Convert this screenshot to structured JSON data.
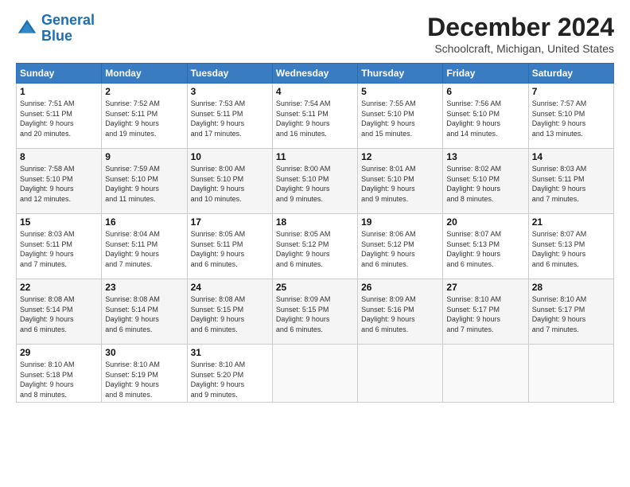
{
  "logo": {
    "line1": "General",
    "line2": "Blue"
  },
  "title": "December 2024",
  "location": "Schoolcraft, Michigan, United States",
  "days_of_week": [
    "Sunday",
    "Monday",
    "Tuesday",
    "Wednesday",
    "Thursday",
    "Friday",
    "Saturday"
  ],
  "weeks": [
    [
      {
        "day": "1",
        "info": "Sunrise: 7:51 AM\nSunset: 5:11 PM\nDaylight: 9 hours\nand 20 minutes."
      },
      {
        "day": "2",
        "info": "Sunrise: 7:52 AM\nSunset: 5:11 PM\nDaylight: 9 hours\nand 19 minutes."
      },
      {
        "day": "3",
        "info": "Sunrise: 7:53 AM\nSunset: 5:11 PM\nDaylight: 9 hours\nand 17 minutes."
      },
      {
        "day": "4",
        "info": "Sunrise: 7:54 AM\nSunset: 5:11 PM\nDaylight: 9 hours\nand 16 minutes."
      },
      {
        "day": "5",
        "info": "Sunrise: 7:55 AM\nSunset: 5:10 PM\nDaylight: 9 hours\nand 15 minutes."
      },
      {
        "day": "6",
        "info": "Sunrise: 7:56 AM\nSunset: 5:10 PM\nDaylight: 9 hours\nand 14 minutes."
      },
      {
        "day": "7",
        "info": "Sunrise: 7:57 AM\nSunset: 5:10 PM\nDaylight: 9 hours\nand 13 minutes."
      }
    ],
    [
      {
        "day": "8",
        "info": "Sunrise: 7:58 AM\nSunset: 5:10 PM\nDaylight: 9 hours\nand 12 minutes."
      },
      {
        "day": "9",
        "info": "Sunrise: 7:59 AM\nSunset: 5:10 PM\nDaylight: 9 hours\nand 11 minutes."
      },
      {
        "day": "10",
        "info": "Sunrise: 8:00 AM\nSunset: 5:10 PM\nDaylight: 9 hours\nand 10 minutes."
      },
      {
        "day": "11",
        "info": "Sunrise: 8:00 AM\nSunset: 5:10 PM\nDaylight: 9 hours\nand 9 minutes."
      },
      {
        "day": "12",
        "info": "Sunrise: 8:01 AM\nSunset: 5:10 PM\nDaylight: 9 hours\nand 9 minutes."
      },
      {
        "day": "13",
        "info": "Sunrise: 8:02 AM\nSunset: 5:10 PM\nDaylight: 9 hours\nand 8 minutes."
      },
      {
        "day": "14",
        "info": "Sunrise: 8:03 AM\nSunset: 5:11 PM\nDaylight: 9 hours\nand 7 minutes."
      }
    ],
    [
      {
        "day": "15",
        "info": "Sunrise: 8:03 AM\nSunset: 5:11 PM\nDaylight: 9 hours\nand 7 minutes."
      },
      {
        "day": "16",
        "info": "Sunrise: 8:04 AM\nSunset: 5:11 PM\nDaylight: 9 hours\nand 7 minutes."
      },
      {
        "day": "17",
        "info": "Sunrise: 8:05 AM\nSunset: 5:11 PM\nDaylight: 9 hours\nand 6 minutes."
      },
      {
        "day": "18",
        "info": "Sunrise: 8:05 AM\nSunset: 5:12 PM\nDaylight: 9 hours\nand 6 minutes."
      },
      {
        "day": "19",
        "info": "Sunrise: 8:06 AM\nSunset: 5:12 PM\nDaylight: 9 hours\nand 6 minutes."
      },
      {
        "day": "20",
        "info": "Sunrise: 8:07 AM\nSunset: 5:13 PM\nDaylight: 9 hours\nand 6 minutes."
      },
      {
        "day": "21",
        "info": "Sunrise: 8:07 AM\nSunset: 5:13 PM\nDaylight: 9 hours\nand 6 minutes."
      }
    ],
    [
      {
        "day": "22",
        "info": "Sunrise: 8:08 AM\nSunset: 5:14 PM\nDaylight: 9 hours\nand 6 minutes."
      },
      {
        "day": "23",
        "info": "Sunrise: 8:08 AM\nSunset: 5:14 PM\nDaylight: 9 hours\nand 6 minutes."
      },
      {
        "day": "24",
        "info": "Sunrise: 8:08 AM\nSunset: 5:15 PM\nDaylight: 9 hours\nand 6 minutes."
      },
      {
        "day": "25",
        "info": "Sunrise: 8:09 AM\nSunset: 5:15 PM\nDaylight: 9 hours\nand 6 minutes."
      },
      {
        "day": "26",
        "info": "Sunrise: 8:09 AM\nSunset: 5:16 PM\nDaylight: 9 hours\nand 6 minutes."
      },
      {
        "day": "27",
        "info": "Sunrise: 8:10 AM\nSunset: 5:17 PM\nDaylight: 9 hours\nand 7 minutes."
      },
      {
        "day": "28",
        "info": "Sunrise: 8:10 AM\nSunset: 5:17 PM\nDaylight: 9 hours\nand 7 minutes."
      }
    ],
    [
      {
        "day": "29",
        "info": "Sunrise: 8:10 AM\nSunset: 5:18 PM\nDaylight: 9 hours\nand 8 minutes."
      },
      {
        "day": "30",
        "info": "Sunrise: 8:10 AM\nSunset: 5:19 PM\nDaylight: 9 hours\nand 8 minutes."
      },
      {
        "day": "31",
        "info": "Sunrise: 8:10 AM\nSunset: 5:20 PM\nDaylight: 9 hours\nand 9 minutes."
      },
      {
        "day": "",
        "info": ""
      },
      {
        "day": "",
        "info": ""
      },
      {
        "day": "",
        "info": ""
      },
      {
        "day": "",
        "info": ""
      }
    ]
  ]
}
